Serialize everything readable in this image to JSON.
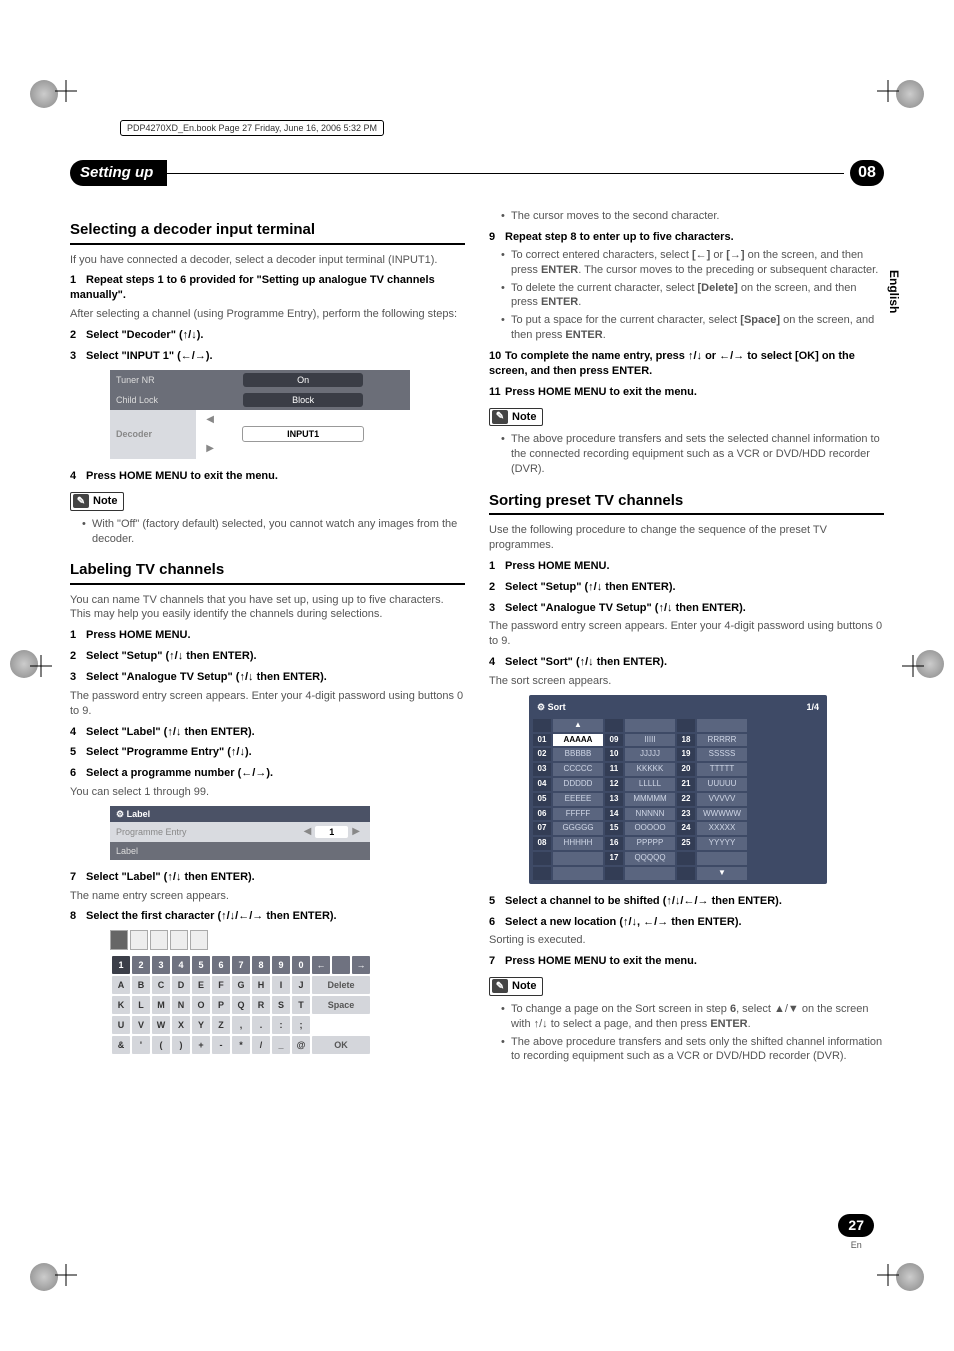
{
  "bookline": "PDP4270XD_En.book  Page 27  Friday, June 16, 2006  5:32 PM",
  "chapter": {
    "title": "Setting up",
    "number": "08"
  },
  "side_tab": "English",
  "page_number": "27",
  "page_lang": "En",
  "left": {
    "h_decoder": "Selecting a decoder input terminal",
    "decoder_intro": "If you have connected a decoder, select a decoder input terminal (INPUT1).",
    "s1_num": "1",
    "s1_txt": "Repeat steps 1 to 6 provided for \"Setting up analogue TV channels manually\".",
    "s1_sub": "After selecting a channel (using Programme Entry), perform the following steps:",
    "s2_num": "2",
    "s2_txt": "Select \"Decoder\" (↑/↓).",
    "s3_num": "3",
    "s3_txt": "Select \"INPUT 1\" (←/→).",
    "decoder_table": {
      "r1k": "Tuner NR",
      "r1v": "On",
      "r2k": "Child Lock",
      "r2v": "Block",
      "r3k": "Decoder",
      "r3v": "INPUT1"
    },
    "s4_num": "4",
    "s4_txt": "Press HOME MENU to exit the menu.",
    "note_label": "Note",
    "note1": "With \"Off\" (factory default) selected, you cannot watch any images from the decoder.",
    "h_label": "Labeling TV channels",
    "label_intro": "You can name TV channels that you have set up, using up to five characters. This may help you easily identify the channels during selections.",
    "l1_num": "1",
    "l1_txt": "Press HOME MENU.",
    "l2_num": "2",
    "l2_txt": "Select \"Setup\" (↑/↓ then ENTER).",
    "l3_num": "3",
    "l3_txt": "Select \"Analogue TV Setup\" (↑/↓ then ENTER).",
    "l3_sub": "The password entry screen appears. Enter your 4-digit password using buttons 0 to 9.",
    "l4_num": "4",
    "l4_txt": "Select \"Label\" (↑/↓ then ENTER).",
    "l5_num": "5",
    "l5_txt": "Select \"Programme Entry\" (↑/↓).",
    "l6_num": "6",
    "l6_txt": "Select a programme number (←/→).",
    "l6_sub": "You can select 1 through 99.",
    "label_ui": {
      "header": "Label",
      "row1k": "Programme Entry",
      "row1v": "1",
      "row2k": "Label"
    },
    "l7_num": "7",
    "l7_txt": "Select \"Label\" (↑/↓ then ENTER).",
    "l7_sub": "The name entry screen appears.",
    "l8_num": "8",
    "l8_txt": "Select the first character (↑/↓/←/→ then ENTER).",
    "kb": {
      "row1": [
        "1",
        "2",
        "3",
        "4",
        "5",
        "6",
        "7",
        "8",
        "9",
        "0",
        "←",
        "",
        "→"
      ],
      "row2": [
        "A",
        "B",
        "C",
        "D",
        "E",
        "F",
        "G",
        "H",
        "I",
        "J"
      ],
      "row3": [
        "K",
        "L",
        "M",
        "N",
        "O",
        "P",
        "Q",
        "R",
        "S",
        "T"
      ],
      "row4": [
        "U",
        "V",
        "W",
        "X",
        "Y",
        "Z",
        ",",
        ".",
        ":",
        ";"
      ],
      "row5": [
        "&",
        "'",
        "(",
        ")",
        "+",
        "-",
        "*",
        "/",
        "_",
        "@"
      ],
      "btn_delete": "Delete",
      "btn_space": "Space",
      "btn_ok": "OK"
    }
  },
  "right": {
    "cursor_moves": "The cursor moves to the second character.",
    "r9_num": "9",
    "r9_txt": "Repeat step 8 to enter up to five characters.",
    "r9_b1a": "To correct entered characters, select ",
    "r9_b1_key1": "[←]",
    "r9_b1_or": " or ",
    "r9_b1_key2": "[→]",
    "r9_b1b": " on the screen, and then press ",
    "r9_b1_enter": "ENTER",
    "r9_b1c": ". The cursor moves to the preceding or subsequent character.",
    "r9_b2a": "To delete the current character, select ",
    "r9_b2_key": "[Delete]",
    "r9_b2b": " on the screen, and then press ",
    "r9_b2_enter": "ENTER",
    "r9_b2c": ".",
    "r9_b3a": "To put a space for the current character, select ",
    "r9_b3_key": "[Space]",
    "r9_b3b": " on the screen, and then press ",
    "r9_b3_enter": "ENTER",
    "r9_b3c": ".",
    "r10_num": "10",
    "r10_txt": "To complete the name entry, press ↑/↓ or ←/→ to select [OK] on the screen, and then press ENTER.",
    "r11_num": "11",
    "r11_txt": "Press HOME MENU to exit the menu.",
    "note_label": "Note",
    "note2": "The above procedure transfers and sets the selected channel information to the connected recording equipment such as a VCR or DVD/HDD recorder (DVR).",
    "h_sort": "Sorting preset TV channels",
    "sort_intro": "Use the following procedure to change the sequence of the preset TV programmes.",
    "so1_num": "1",
    "so1_txt": "Press HOME MENU.",
    "so2_num": "2",
    "so2_txt": "Select \"Setup\" (↑/↓ then ENTER).",
    "so3_num": "3",
    "so3_txt": "Select \"Analogue TV Setup\" (↑/↓ then ENTER).",
    "so3_sub": "The password entry screen appears. Enter your 4-digit password using buttons 0 to 9.",
    "so4_num": "4",
    "so4_txt": "Select \"Sort\" (↑/↓ then ENTER).",
    "so4_sub": "The sort screen appears.",
    "sort_ui": {
      "title": "Sort",
      "page": "1/4",
      "cells": [
        [
          "01",
          "AAAAA",
          "09",
          "IIIII",
          "18",
          "RRRRR"
        ],
        [
          "02",
          "BBBBB",
          "10",
          "JJJJJ",
          "19",
          "SSSSS"
        ],
        [
          "03",
          "CCCCC",
          "11",
          "KKKKK",
          "20",
          "TTTTT"
        ],
        [
          "04",
          "DDDDD",
          "12",
          "LLLLL",
          "21",
          "UUUUU"
        ],
        [
          "05",
          "EEEEE",
          "13",
          "MMMMM",
          "22",
          "VVVVV"
        ],
        [
          "06",
          "FFFFF",
          "14",
          "NNNNN",
          "23",
          "WWWWW"
        ],
        [
          "07",
          "GGGGG",
          "15",
          "OOOOO",
          "24",
          "XXXXX"
        ],
        [
          "08",
          "HHHHH",
          "16",
          "PPPPP",
          "25",
          "YYYYY"
        ],
        [
          "",
          "",
          "17",
          "QQQQQ",
          "",
          ""
        ]
      ],
      "up": "▲",
      "down": "▼"
    },
    "so5_num": "5",
    "so5_txt": "Select a channel to be shifted (↑/↓/←/→ then ENTER).",
    "so6_num": "6",
    "so6_txt": "Select a new location (↑/↓, ←/→ then ENTER).",
    "so6_sub": "Sorting is executed.",
    "so7_num": "7",
    "so7_txt": "Press HOME MENU to exit the menu.",
    "note3a": "To change a page on the Sort screen in step ",
    "note3_step": "6",
    "note3b": ", select ▲/▼ on the screen with ↑/↓ to select a page, and then press ",
    "note3_enter": "ENTER",
    "note3c": ".",
    "note4": "The above procedure transfers and sets only the shifted channel information to recording equipment such as a VCR or DVD/HDD recorder (DVR)."
  }
}
